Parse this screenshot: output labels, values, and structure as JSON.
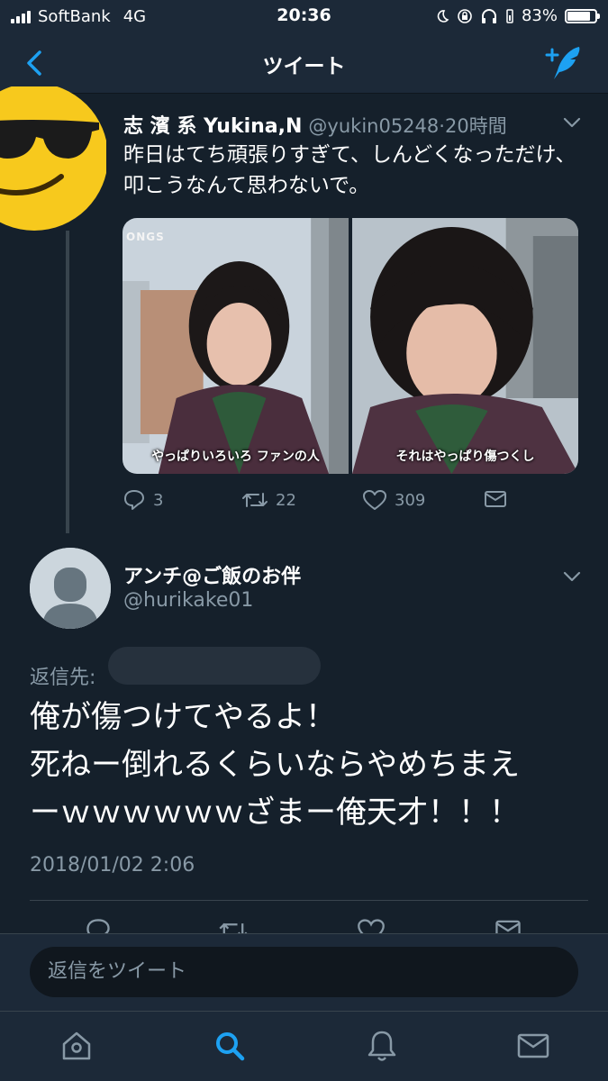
{
  "status_bar": {
    "carrier": "SoftBank",
    "network": "4G",
    "time": "20:36",
    "battery": "83%",
    "battery_level": 0.83
  },
  "nav": {
    "title": "ツイート"
  },
  "parent_tweet": {
    "name": "志 濱 系 Yukina,N",
    "handle": "@yukin05248",
    "separator": "·",
    "time_ago": "20時間",
    "text": "昨日はてち頑張りすぎて、しんどくなっただけ、叩こうなんて思わないで。",
    "photos": [
      {
        "caption": "やっぱりいろいろ ファンの人",
        "watermark": "ONGS"
      },
      {
        "caption": "それはやっぱり傷つくし"
      }
    ],
    "replies": "3",
    "retweets": "22",
    "likes": "309"
  },
  "reply_tweet": {
    "name": "アンチ@ご飯のお伴",
    "handle": "@hurikake01",
    "reply_to_label": "返信先:",
    "text": "俺が傷つけてやるよ！\n死ねー倒れるくらいならやめちまえ\nーｗｗｗｗｗｗざまー俺天才！！！",
    "timestamp": "2018/01/02 2:06"
  },
  "reply_bar": {
    "placeholder": "返信をツイート"
  },
  "colors": {
    "background": "#15202b",
    "bar": "#1c2938",
    "accent": "#1da1f2",
    "secondary_text": "#8899a6"
  },
  "icons": [
    "back-chevron-icon",
    "compose-tweet-icon",
    "chevron-down-icon",
    "reply-icon",
    "retweet-icon",
    "like-icon",
    "dm-icon",
    "home-icon",
    "search-icon",
    "notifications-icon",
    "messages-icon"
  ]
}
